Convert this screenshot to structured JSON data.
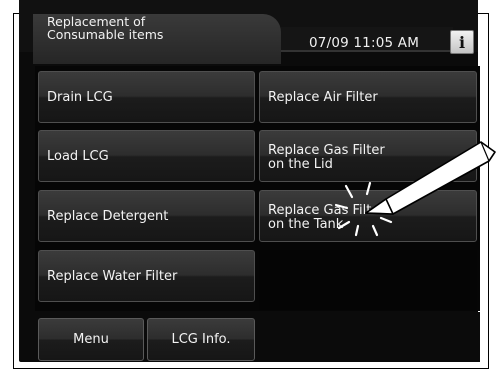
{
  "header": {
    "title_line1": "Replacement of",
    "title_line2": "Consumable items",
    "datetime": "07/09 11:05 AM",
    "info_icon": "i"
  },
  "buttons": [
    {
      "label": "Drain LCG"
    },
    {
      "label": "Replace Air Filter"
    },
    {
      "label": "Load LCG"
    },
    {
      "label_line1": "Replace Gas Filter",
      "label_line2": "on the Lid"
    },
    {
      "label": "Replace Detergent"
    },
    {
      "label_line1": "Replace Gas Filter",
      "label_line2": "on the Tank"
    },
    {
      "label": "Replace Water Filter"
    }
  ],
  "footer": {
    "menu_label": "Menu",
    "lcg_info_label": "LCG Info."
  },
  "icons": {
    "info": "info-icon",
    "stylus": "stylus-icon",
    "tap_indicator": "tap-burst-icon"
  },
  "colors": {
    "screen_bg": "#0b0b0b",
    "button_top": "#3b3b3b",
    "button_bottom": "#161616",
    "text": "#f3f3f3"
  }
}
